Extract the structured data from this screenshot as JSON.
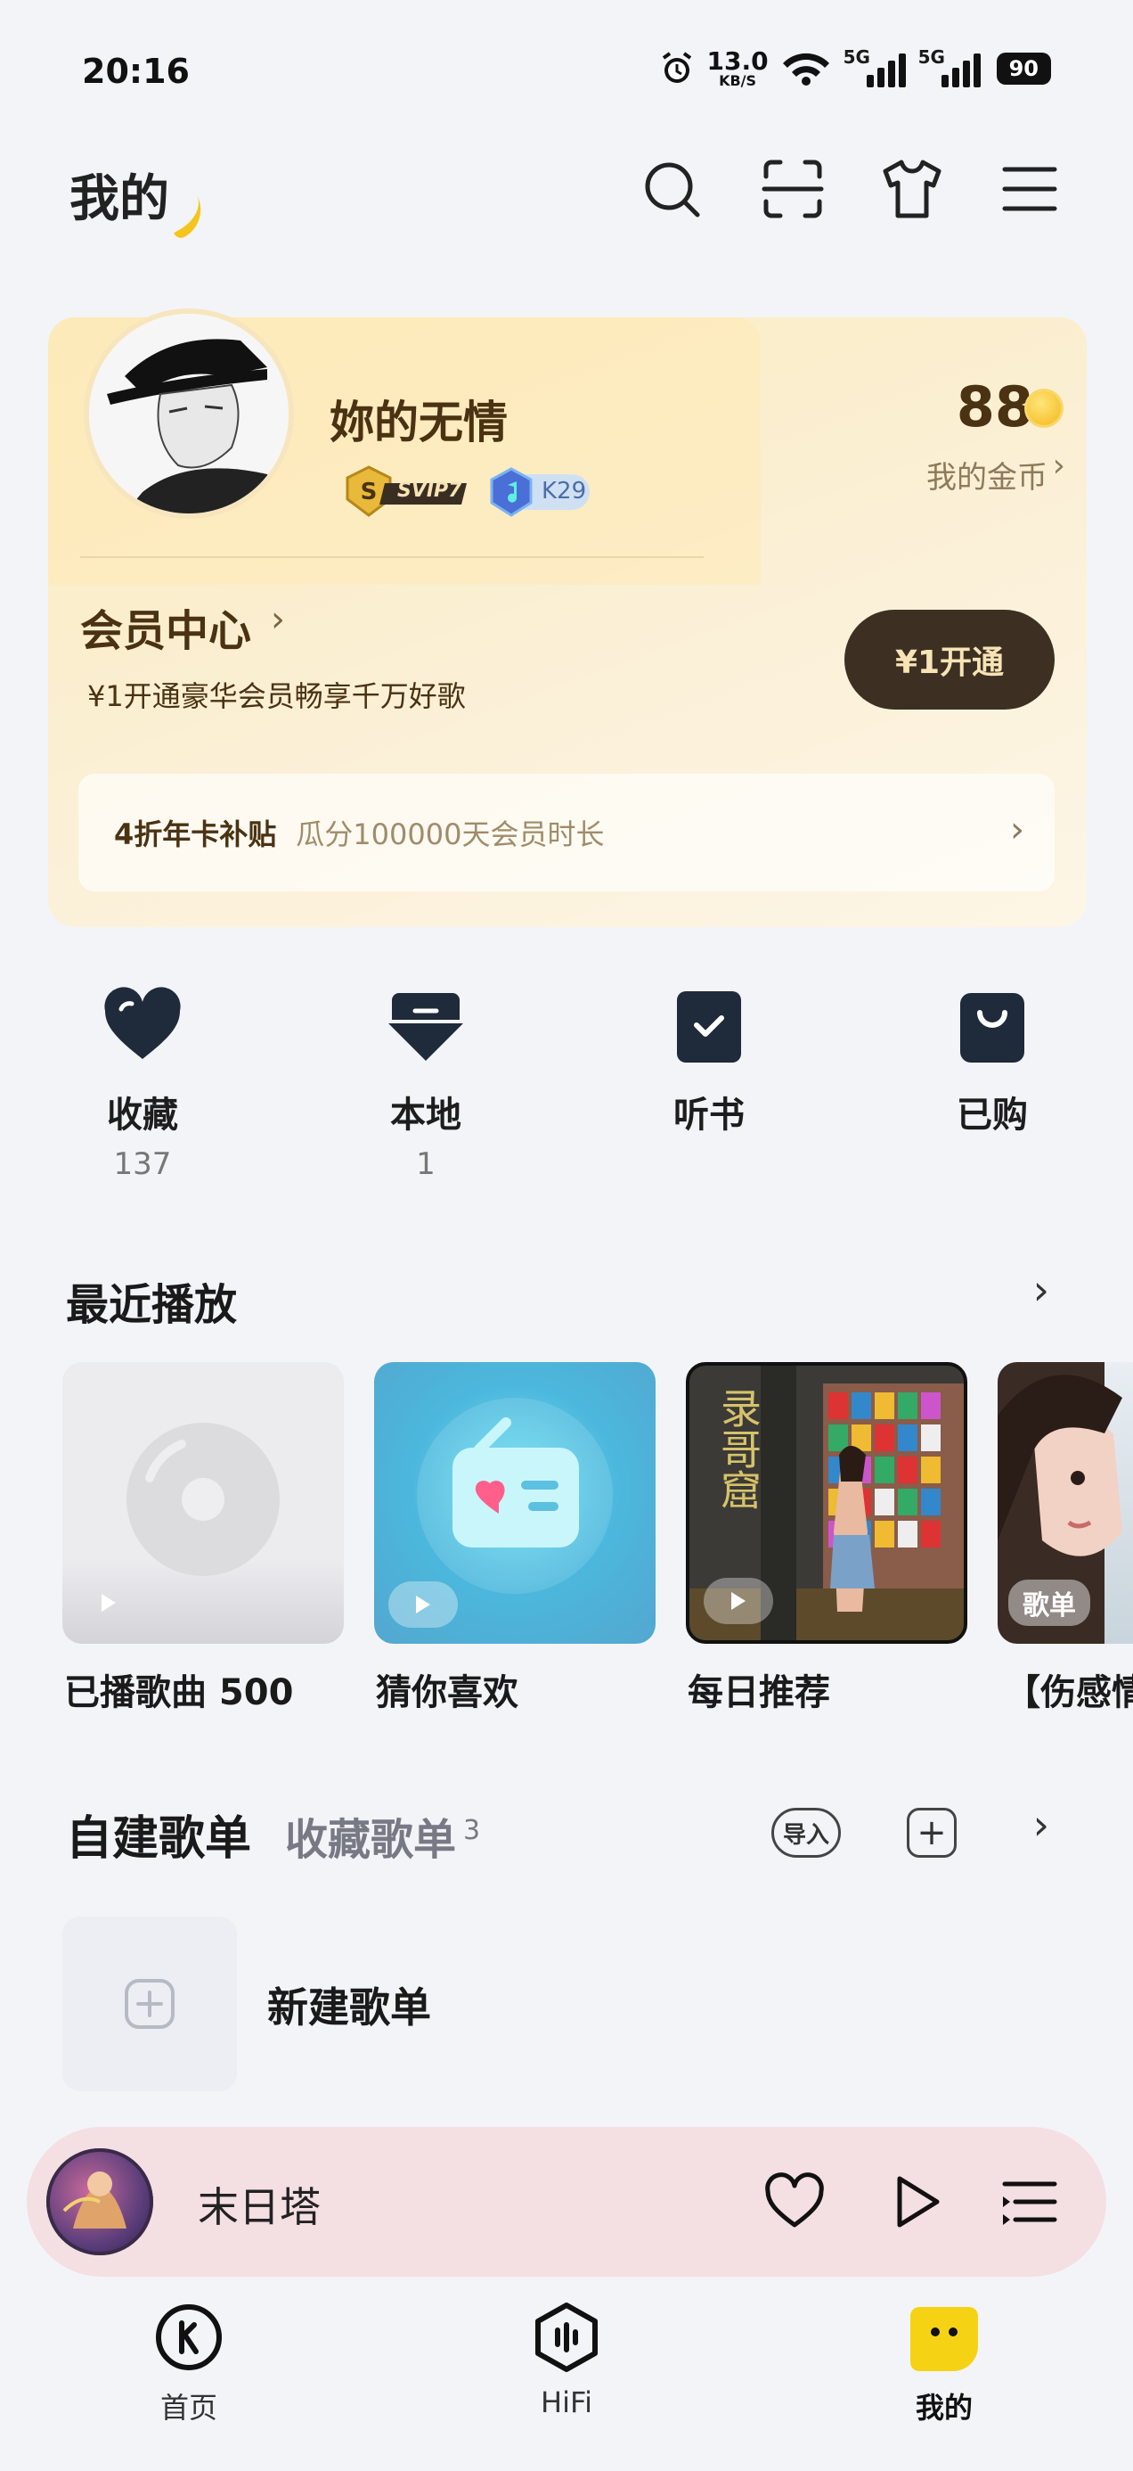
{
  "status_bar": {
    "time": "20:16",
    "speed_value": "13.0",
    "speed_unit": "KB/S",
    "sim1": "5G",
    "sim2": "5G",
    "battery": "90"
  },
  "header": {
    "title": "我的"
  },
  "profile": {
    "name": "妳的无情",
    "svip_badge": "SVIP7",
    "k_badge": "K29",
    "coins": "88",
    "coins_label": "我的金币"
  },
  "vip": {
    "center_label": "会员中心",
    "description": "¥1开通豪华会员畅享千万好歌",
    "open_button": "¥1开通",
    "promo_title": "4折年卡补贴",
    "promo_desc": "瓜分100000天会员时长"
  },
  "quick": {
    "favorites": {
      "label": "收藏",
      "count": "137"
    },
    "local": {
      "label": "本地",
      "count": "1"
    },
    "audiobook": {
      "label": "听书"
    },
    "purchased": {
      "label": "已购"
    }
  },
  "recent": {
    "title": "最近播放",
    "items": [
      {
        "label": "已播歌曲 500"
      },
      {
        "label": "猜你喜欢"
      },
      {
        "label": "每日推荐",
        "art_text": "录哥窟"
      },
      {
        "label": "【伤感情",
        "tag": "歌单"
      }
    ]
  },
  "playlists": {
    "tab_created": "自建歌单",
    "tab_collected": "收藏歌单",
    "collected_count": "3",
    "import_label": "导入",
    "new_playlist": "新建歌单"
  },
  "player": {
    "title": "末日塔"
  },
  "nav": {
    "home": "首页",
    "hifi": "HiFi",
    "mine": "我的"
  },
  "colors": {
    "accent_yellow": "#f6c51d",
    "vip_dark": "#3d3023",
    "player_bg": "#f4dfe3"
  }
}
